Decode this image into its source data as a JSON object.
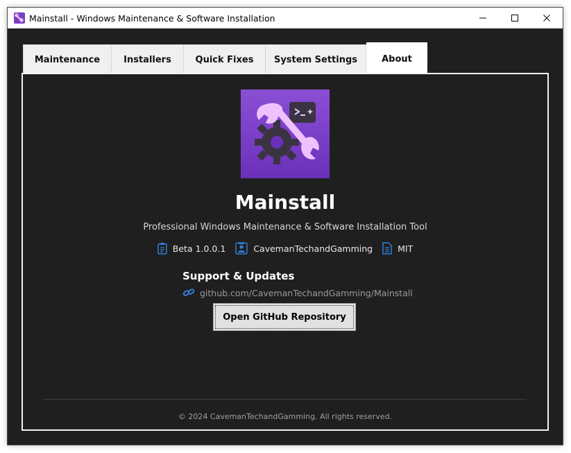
{
  "window": {
    "title": "Mainstall - Windows Maintenance & Software Installation",
    "icon": "wrench-gear-icon"
  },
  "tabs": [
    {
      "label": "Maintenance",
      "active": false
    },
    {
      "label": "Installers",
      "active": false
    },
    {
      "label": "Quick Fixes",
      "active": false
    },
    {
      "label": "System Settings",
      "active": false
    },
    {
      "label": "About",
      "active": true
    }
  ],
  "about": {
    "app_name": "Mainstall",
    "tagline": "Professional Windows Maintenance & Software Installation Tool",
    "meta": {
      "version": "Beta 1.0.0.1",
      "author": "CavemanTechandGamming",
      "license": "MIT"
    },
    "support_heading": "Support & Updates",
    "repo_url": "github.com/CavemanTechandGamming/Mainstall",
    "github_button": "Open GitHub Repository",
    "copyright": "© 2024 CavemanTechandGamming. All rights reserved."
  },
  "colors": {
    "background": "#1f1f1f",
    "logo_purple": "#7b3fc4",
    "icon_blue": "#2f7fd8",
    "text_white": "#ffffff"
  }
}
